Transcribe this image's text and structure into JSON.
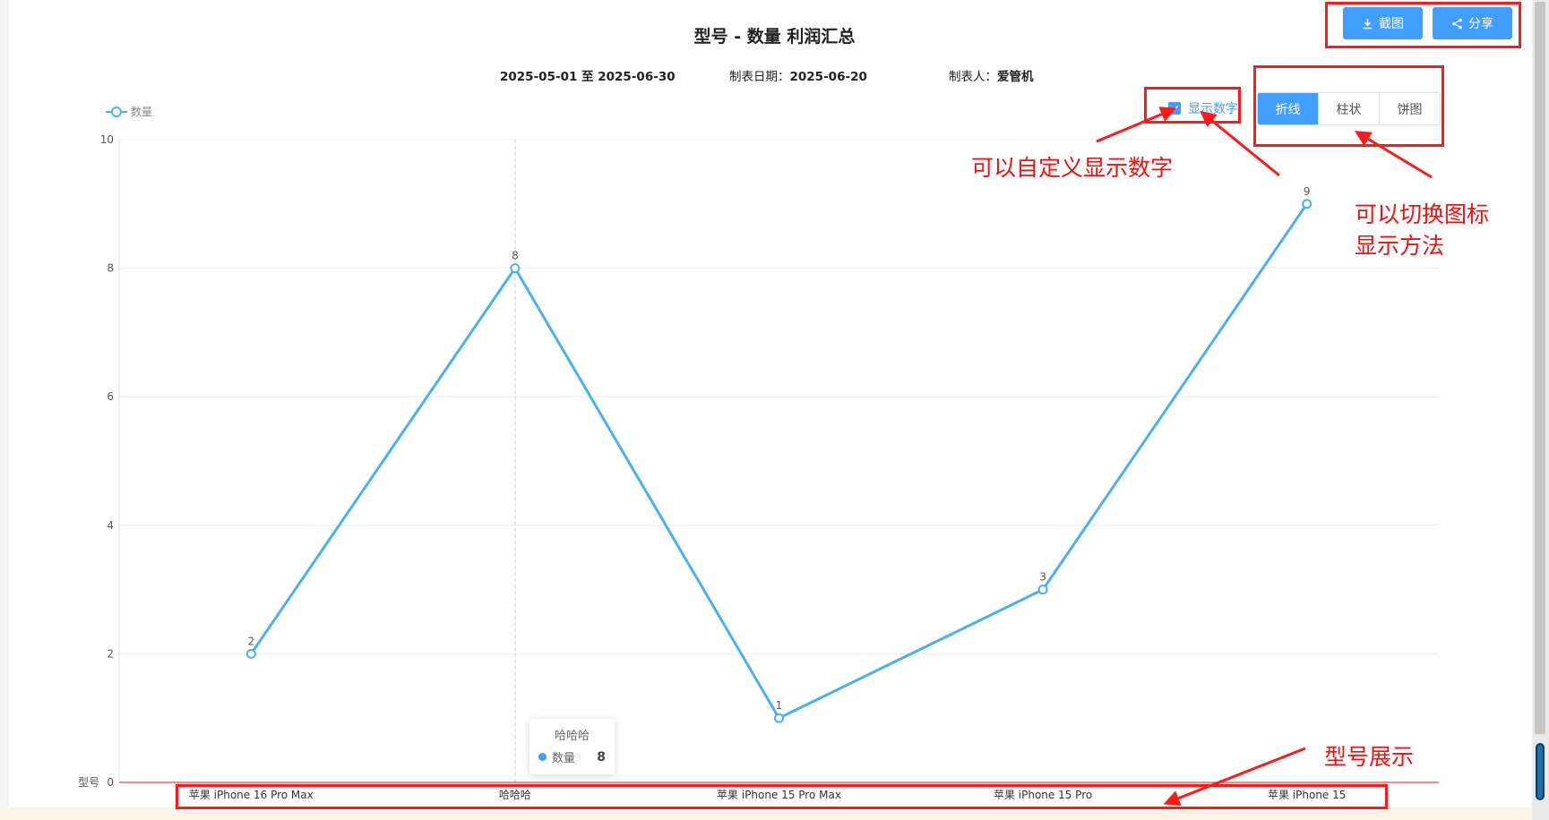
{
  "report": {
    "title": "型号 - 数量 利润汇总",
    "date_range": "2025-05-01 至 2025-06-30",
    "created_date_label": "制表日期：",
    "created_date": "2025-06-20",
    "creator_label": "制表人：",
    "creator": "爱管机"
  },
  "toolbar": {
    "screenshot_label": "截图",
    "share_label": "分享"
  },
  "chart_type_switch": {
    "options": [
      "折线",
      "柱状",
      "饼图"
    ],
    "selected": "折线"
  },
  "show_numbers": {
    "label": "显示数字",
    "checked": true
  },
  "tooltip": {
    "title": "哈哈哈",
    "series": "数量",
    "value": "8"
  },
  "annotations": {
    "custom_numbers": "可以自定义显示数字",
    "switch_chart_line1": "可以切换图标",
    "switch_chart_line2": "显示方法",
    "model_display": "型号展示"
  },
  "colors": {
    "accent": "#409eff",
    "line": "#4aaff5",
    "annotation": "#ff1a1a"
  },
  "chart_data": {
    "type": "line",
    "title": "",
    "xlabel": "型号",
    "ylabel": "",
    "categories": [
      "苹果 iPhone 16 Pro Max",
      "哈哈哈",
      "苹果 iPhone 15 Pro Max",
      "苹果 iPhone 15 Pro",
      "苹果 iPhone 15"
    ],
    "series": [
      {
        "name": "数量",
        "values": [
          2,
          8,
          1,
          3,
          9
        ]
      }
    ],
    "ylim": [
      0,
      10
    ],
    "yticks": [
      0,
      2,
      4,
      6,
      8,
      10
    ],
    "data_labels": true,
    "grid": true,
    "legend_position": "top-left",
    "highlighted_category": "哈哈哈"
  }
}
